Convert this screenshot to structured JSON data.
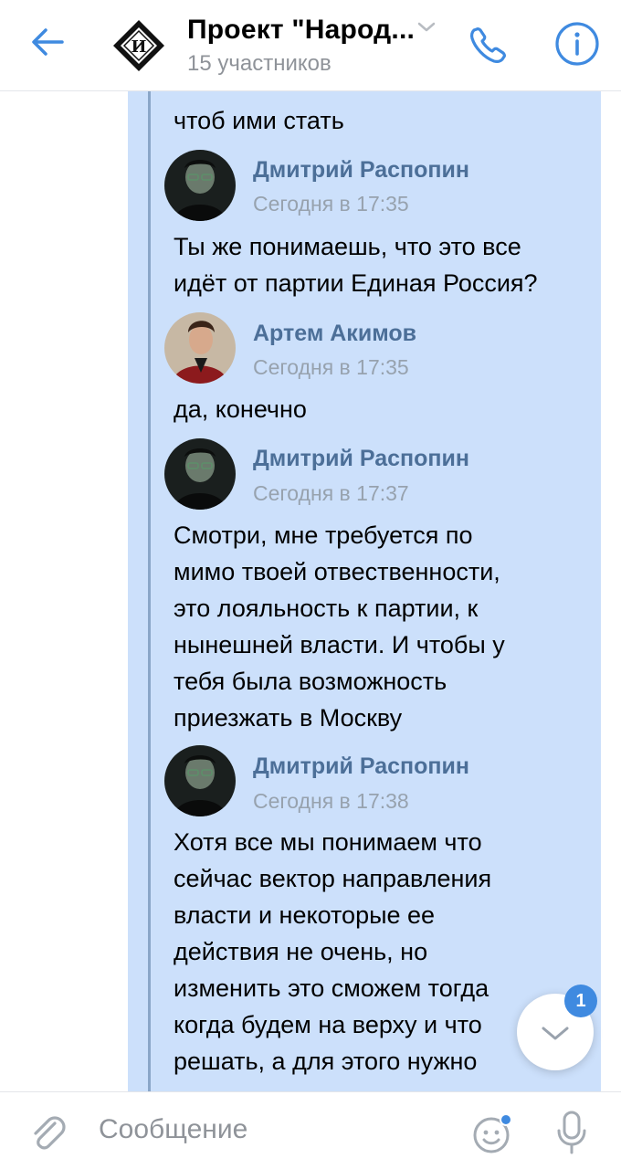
{
  "header": {
    "back_icon": "arrow-left-icon",
    "logo_letter": "И",
    "title": "Проект \"Народ...",
    "subtitle": "15 участников",
    "call_icon": "phone-icon",
    "info_icon": "info-icon",
    "accent": "#3f8ae0"
  },
  "chat": {
    "bubble_color": "#cce0fb",
    "top_fragment": "чтоб ими стать",
    "messages": [
      {
        "author": "Дмитрий Распопин",
        "time": "Сегодня в 17:35",
        "lines": [
          "Ты же понимаешь, что это все",
          "идёт от партии Единая Россия?"
        ]
      },
      {
        "author": "Артем Акимов",
        "time": "Сегодня в 17:35",
        "lines": [
          "да, конечно"
        ]
      },
      {
        "author": "Дмитрий Распопин",
        "time": "Сегодня в 17:37",
        "lines": [
          "Смотри, мне требуется по",
          "мимо твоей отвественности,",
          "это лояльность к партии, к",
          "нынешней власти. И чтобы у",
          "тебя была возможность",
          "приезжать в Москву"
        ]
      },
      {
        "author": "Дмитрий Распопин",
        "time": "Сегодня в 17:38",
        "lines": [
          "Хотя все мы понимаем что",
          "сейчас вектор направления",
          "власти и некоторые ее",
          "действия не очень, но",
          "изменить это сможем тогда",
          "когда будем на верху и что",
          "решать, а для этого нужно"
        ]
      }
    ],
    "unread_badge": "1"
  },
  "composer": {
    "placeholder": "Сообщение",
    "attach_icon": "paperclip-icon",
    "emoji_icon": "smile-icon",
    "mic_icon": "microphone-icon"
  }
}
